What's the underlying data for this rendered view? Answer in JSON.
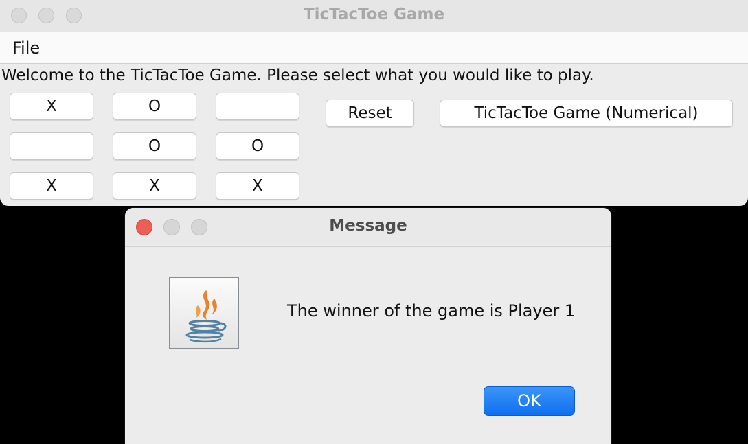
{
  "main_window": {
    "title": "TicTacToe Game",
    "menu": {
      "file": "File"
    },
    "welcome_text": "Welcome to the TicTacToe Game.  Please select what you would like to play.",
    "board": [
      [
        "X",
        "O",
        ""
      ],
      [
        "",
        "O",
        "O"
      ],
      [
        "X",
        "X",
        "X"
      ]
    ],
    "reset_label": "Reset",
    "mode_label": "TicTacToe Game  (Numerical)"
  },
  "dialog": {
    "title": "Message",
    "message": "The winner of the game is Player 1",
    "ok_label": "OK",
    "icon": "java-logo-icon"
  },
  "colors": {
    "close": "#ec5f57",
    "inactive": "#d9d9d9",
    "ok_button": "#1c7cf4",
    "java_orange": "#e8822b",
    "java_blue": "#5382a1"
  }
}
